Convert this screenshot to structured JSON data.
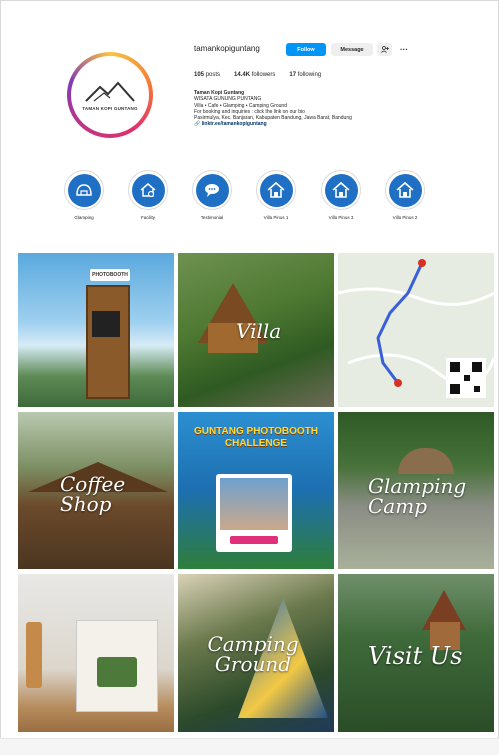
{
  "profile": {
    "username": "tamankopiguntang",
    "follow_label": "Follow",
    "message_label": "Message",
    "more_label": "···",
    "posts_count": "105",
    "posts_label": "posts",
    "followers_count": "14.4K",
    "followers_label": "followers",
    "following_count": "17",
    "following_label": "following",
    "avatar_text": "TAMAN KOPI GUNTANG",
    "bio_name": "Taman Kopi Guntang",
    "bio_line1": "WISATA GUNUNG PUNTANG",
    "bio_line2": "Villa • Cafe • Glamping • Camping Ground",
    "bio_line3": "For booking and inquiries : click the link on our bio",
    "bio_line4": "Pasirmulya, Kec. Banjaran, Kabupaten Bandung, Jawa Barat, Bandung",
    "bio_link": "linktr.ee/tamankopiguntang"
  },
  "highlights": [
    {
      "label": "Glamping",
      "icon": "dome-icon"
    },
    {
      "label": "Facility",
      "icon": "house-gear-icon"
    },
    {
      "label": "Testimonial",
      "icon": "chat-icon"
    },
    {
      "label": "Villa Pinus 1",
      "icon": "house-icon"
    },
    {
      "label": "Villa Pinus 3",
      "icon": "house-icon"
    },
    {
      "label": "Villa Pinus 2",
      "icon": "house-icon"
    }
  ],
  "posts": [
    {
      "title": "",
      "badge": "PHOTOBOOTH"
    },
    {
      "title": "Villa"
    },
    {
      "title": ""
    },
    {
      "title": "Coffee Shop"
    },
    {
      "title": "GUNTANG PHOTOBOOTH CHALLENGE"
    },
    {
      "title": "Glamping Camp"
    },
    {
      "title": ""
    },
    {
      "title": "Camping Ground"
    },
    {
      "title": "Visit Us"
    }
  ]
}
